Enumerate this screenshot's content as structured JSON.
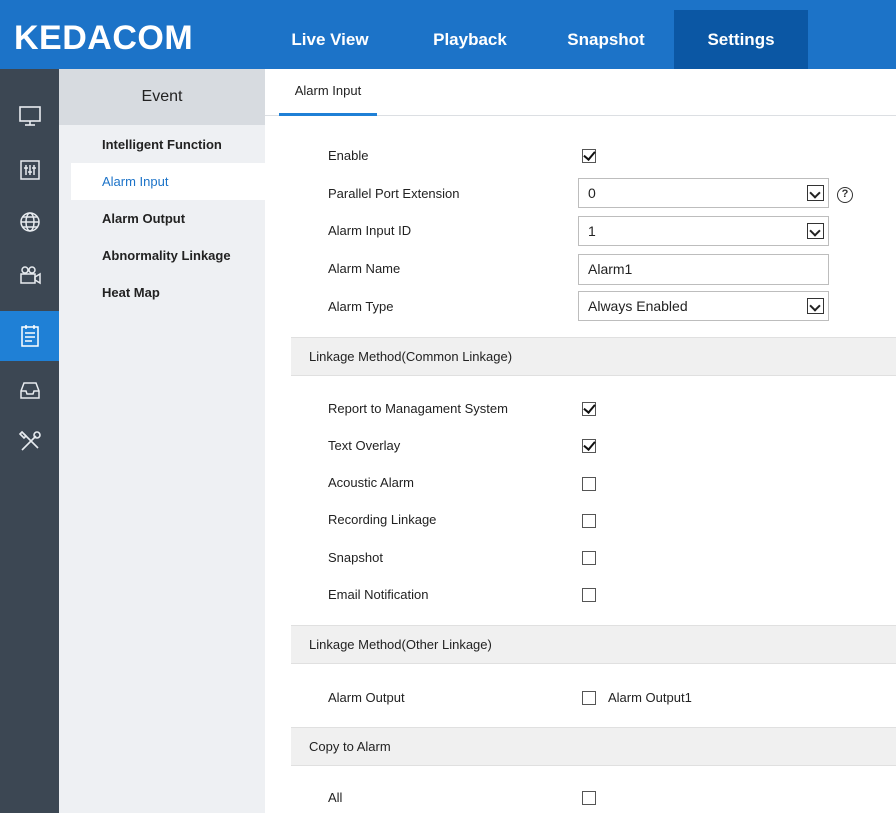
{
  "brand": {
    "logo_text": "KEDACOM",
    "accent": "#1c73c8"
  },
  "topnav": {
    "items": [
      {
        "label": "Live View"
      },
      {
        "label": "Playback"
      },
      {
        "label": "Snapshot"
      },
      {
        "label": "Settings",
        "active": true
      }
    ]
  },
  "rail": {
    "items": [
      {
        "icon": "monitor-icon"
      },
      {
        "icon": "equalizer-icon"
      },
      {
        "icon": "globe-icon"
      },
      {
        "icon": "camera-icon"
      },
      {
        "icon": "event-icon",
        "active": true
      },
      {
        "icon": "storage-icon"
      },
      {
        "icon": "tools-icon"
      }
    ]
  },
  "submenu": {
    "header": "Event",
    "items": [
      {
        "label": "Intelligent Function"
      },
      {
        "label": "Alarm Input",
        "active": true
      },
      {
        "label": "Alarm Output"
      },
      {
        "label": "Abnormality Linkage"
      },
      {
        "label": "Heat Map"
      }
    ]
  },
  "tab": {
    "label": "Alarm Input"
  },
  "form": {
    "enable": {
      "label": "Enable",
      "checked": true
    },
    "parallel_port": {
      "label": "Parallel Port Extension",
      "value": "0"
    },
    "alarm_input_id": {
      "label": "Alarm Input ID",
      "value": "1"
    },
    "alarm_name": {
      "label": "Alarm Name",
      "value": "Alarm1"
    },
    "alarm_type": {
      "label": "Alarm Type",
      "value": "Always Enabled"
    }
  },
  "common_linkage": {
    "title": "Linkage Method(Common Linkage)",
    "items": [
      {
        "label": "Report to Managament System",
        "checked": true
      },
      {
        "label": "Text Overlay",
        "checked": true
      },
      {
        "label": "Acoustic Alarm",
        "checked": false
      },
      {
        "label": "Recording Linkage",
        "checked": false
      },
      {
        "label": "Snapshot",
        "checked": false
      },
      {
        "label": "Email Notification",
        "checked": false
      }
    ]
  },
  "other_linkage": {
    "title": "Linkage Method(Other Linkage)",
    "alarm_output_label": "Alarm Output",
    "alarm_output_option": "Alarm Output1",
    "alarm_output_checked": false
  },
  "copy_to_alarm": {
    "title": "Copy to Alarm",
    "all_label": "All",
    "all_checked": false
  }
}
